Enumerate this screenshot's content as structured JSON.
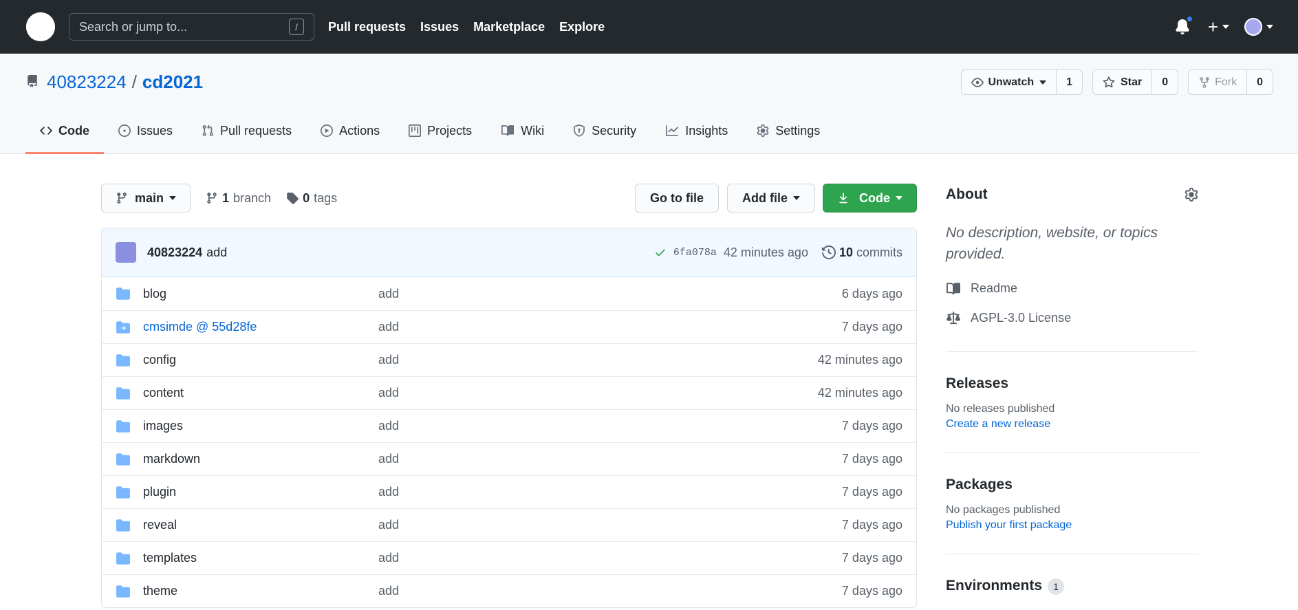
{
  "topnav": {
    "search_placeholder": "Search or jump to...",
    "search_shortcut": "/",
    "links": [
      "Pull requests",
      "Issues",
      "Marketplace",
      "Explore"
    ],
    "plus": "+"
  },
  "repo": {
    "owner": "40823224",
    "separator": "/",
    "name": "cd2021",
    "unwatch_label": "Unwatch",
    "watch_count": "1",
    "star_label": "Star",
    "star_count": "0",
    "fork_label": "Fork",
    "fork_count": "0"
  },
  "tabs": [
    {
      "label": "Code",
      "icon": "code-icon"
    },
    {
      "label": "Issues",
      "icon": "issue-icon"
    },
    {
      "label": "Pull requests",
      "icon": "pull-request-icon"
    },
    {
      "label": "Actions",
      "icon": "play-icon"
    },
    {
      "label": "Projects",
      "icon": "project-icon"
    },
    {
      "label": "Wiki",
      "icon": "book-icon"
    },
    {
      "label": "Security",
      "icon": "shield-icon"
    },
    {
      "label": "Insights",
      "icon": "graph-icon"
    },
    {
      "label": "Settings",
      "icon": "gear-icon"
    }
  ],
  "filebar": {
    "branch": "main",
    "branch_count": "1",
    "branch_label": "branch",
    "tag_count": "0",
    "tag_label": "tags",
    "go_to_file": "Go to file",
    "add_file": "Add file",
    "code": "Code"
  },
  "commit": {
    "author": "40823224",
    "message": "add",
    "sha": "6fa078a",
    "age": "42 minutes ago",
    "count": "10",
    "count_label": "commits"
  },
  "files": [
    {
      "name": "blog",
      "message": "add",
      "age": "6 days ago",
      "type": "folder"
    },
    {
      "name": "cmsimde @ 55d28fe",
      "message": "add",
      "age": "7 days ago",
      "type": "submodule"
    },
    {
      "name": "config",
      "message": "add",
      "age": "42 minutes ago",
      "type": "folder"
    },
    {
      "name": "content",
      "message": "add",
      "age": "42 minutes ago",
      "type": "folder"
    },
    {
      "name": "images",
      "message": "add",
      "age": "7 days ago",
      "type": "folder"
    },
    {
      "name": "markdown",
      "message": "add",
      "age": "7 days ago",
      "type": "folder"
    },
    {
      "name": "plugin",
      "message": "add",
      "age": "7 days ago",
      "type": "folder"
    },
    {
      "name": "reveal",
      "message": "add",
      "age": "7 days ago",
      "type": "folder"
    },
    {
      "name": "templates",
      "message": "add",
      "age": "7 days ago",
      "type": "folder"
    },
    {
      "name": "theme",
      "message": "add",
      "age": "7 days ago",
      "type": "folder"
    }
  ],
  "sidebar": {
    "about_title": "About",
    "about_desc": "No description, website, or topics provided.",
    "readme": "Readme",
    "license": "AGPL-3.0 License",
    "releases_title": "Releases",
    "releases_text": "No releases published",
    "releases_link": "Create a new release",
    "packages_title": "Packages",
    "packages_text": "No packages published",
    "packages_link": "Publish your first package",
    "environments_title": "Environments",
    "environments_count": "1"
  },
  "colors": {
    "header_bg": "#24292e",
    "link": "#0366d6",
    "code_button": "#2ea44f",
    "active_tab": "#f9826c",
    "folder": "#79b8ff"
  }
}
